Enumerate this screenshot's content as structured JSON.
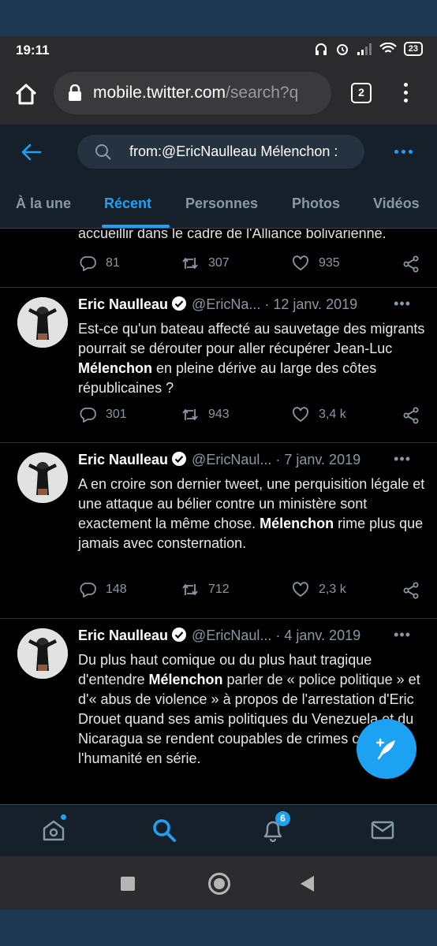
{
  "status_bar": {
    "time": "19:11",
    "battery": "23"
  },
  "browser": {
    "url_host": "mobile.twitter.com",
    "url_path": "/search?q",
    "tab_count": "2"
  },
  "search": {
    "query": "from:@EricNaulleau Mélenchon :"
  },
  "tabs": [
    {
      "label": "À la une"
    },
    {
      "label": "Récent",
      "active": true
    },
    {
      "label": "Personnes"
    },
    {
      "label": "Photos"
    },
    {
      "label": "Vidéos"
    }
  ],
  "partial_tweet": {
    "text": "accueillir dans le cadre de l'Alliance bolivarienne.",
    "replies": "81",
    "retweets": "307",
    "likes": "935"
  },
  "tweets": [
    {
      "name": "Eric Naulleau",
      "handle": "@EricNa...",
      "date": "· 12 janv. 2019",
      "text_parts": [
        "Est-ce qu'un bateau affecté au sauvetage des migrants pourrait se dérouter pour aller récupérer Jean-Luc ",
        "Mélenchon",
        " en pleine dérive au large des côtes républicaines ?"
      ],
      "replies": "301",
      "retweets": "943",
      "likes": "3,4 k"
    },
    {
      "name": "Eric Naulleau",
      "handle": "@EricNaul...",
      "date": "· 7 janv. 2019",
      "text_parts": [
        "A en croire son dernier tweet, une perquisition légale et une attaque au bélier contre un ministère sont exactement la même chose. ",
        "Mélenchon",
        " rime plus que jamais avec consternation."
      ],
      "replies": "148",
      "retweets": "712",
      "likes": "2,3 k"
    },
    {
      "name": "Eric Naulleau",
      "handle": "@EricNaul...",
      "date": "· 4 janv. 2019",
      "text_parts": [
        "Du plus haut comique ou du plus haut tragique d'entendre ",
        "Mélenchon",
        " parler de « police politique » et d'« abus de violence » à propos de l'arrestation d'Eric Drouet quand ses amis politiques du Venezuela et du Nicaragua se rendent coupables de crimes contre l'humanité en série."
      ]
    }
  ],
  "bottom_nav": {
    "notifications_count": "6"
  },
  "colors": {
    "accent": "#1da1f2",
    "header_bg": "#15202b",
    "muted": "#8899a6"
  }
}
